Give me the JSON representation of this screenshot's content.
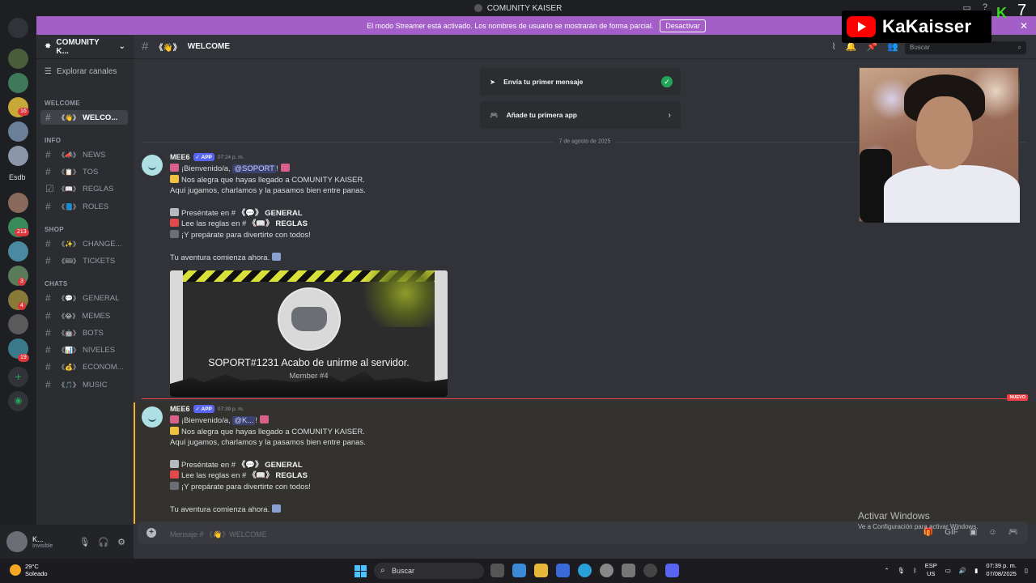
{
  "window": {
    "title": "COMUNITY KAISER"
  },
  "streamer_bar": {
    "text": "El modo Streamer está activado. Los nombres de usuario se mostrarán de forma parcial.",
    "button": "Desactivar"
  },
  "servers": {
    "label_esdb": "Esdb",
    "badges": [
      "16",
      "213",
      "3",
      "4",
      "19"
    ]
  },
  "guild": {
    "name": "COMUNITY K...",
    "explore": "Explorar canales"
  },
  "categories": {
    "welcome": "WELCOME",
    "info": "INFO",
    "shop": "SHOP",
    "chats": "CHATS"
  },
  "channels": {
    "welcome": "WELCO...",
    "news": "NEWS",
    "tos": "TOS",
    "reglas": "REGLAS",
    "roles": "ROLES",
    "change": "CHANGE...",
    "tickets": "TICKETS",
    "general": "GENERAL",
    "memes": "MEMES",
    "bots": "BOTS",
    "niveles": "NIVELES",
    "econom": "ECONOM...",
    "music": "MUSIC"
  },
  "user_panel": {
    "name": "K...",
    "status": "Invisible"
  },
  "header": {
    "channel": "WELCOME",
    "search_placeholder": "Buscar"
  },
  "onboarding": {
    "first_message": "Envía tu primer mensaje",
    "first_app": "Añade tu primera app"
  },
  "date_divider": "7 de agosto de 2025",
  "messages": [
    {
      "author": "MEE6",
      "badge": "APP",
      "time": "07:24 p. m.",
      "l1a": "¡Bienvenido/a, ",
      "mention": "@SOPORT",
      "l1b": "!",
      "l2": "Nos alegra que hayas llegado a COMUNITY KAISER.",
      "l3": "Aquí jugamos, charlamos y la pasamos bien entre panas.",
      "l4": "Preséntate en #",
      "l4chan": "GENERAL",
      "l5": "Lee las reglas en  #",
      "l5chan": "REGLAS",
      "l6": "¡Y prepárate para divertirte con todos!",
      "l7": "Tu aventura comienza ahora."
    },
    {
      "author": "MEE6",
      "badge": "APP",
      "time": "07:39 p. m.",
      "l1a": "¡Bienvenido/a, ",
      "mention": "@K...",
      "l1b": "!",
      "l2": "Nos alegra que hayas llegado a COMUNITY KAISER.",
      "l3": "Aquí jugamos, charlamos y la pasamos bien entre panas.",
      "l4": "Preséntate en #",
      "l4chan": "GENERAL",
      "l5": "Lee las reglas en  #",
      "l5chan": "REGLAS",
      "l6": "¡Y prepárate para divertirte con todos!",
      "l7": "Tu aventura comienza ahora."
    }
  ],
  "welcome_banner": {
    "text": "SOPORT#1231 Acabo de unirme al servidor.",
    "sub": "Member #4"
  },
  "new_marker": "NUEVO",
  "composer": {
    "placeholder": "Mensaje #  《👋》WELCOME"
  },
  "watermark": {
    "title": "Activar Windows",
    "sub": "Ve a Configuración para activar Windows."
  },
  "overlay": {
    "channel_name": "KaKaisser",
    "number": "7"
  },
  "taskbar": {
    "temp": "29°C",
    "weather": "Soleado",
    "search": "Buscar",
    "lang1": "ESP",
    "lang2": "US",
    "time": "07:39 p. m.",
    "date": "07/08/2025"
  }
}
